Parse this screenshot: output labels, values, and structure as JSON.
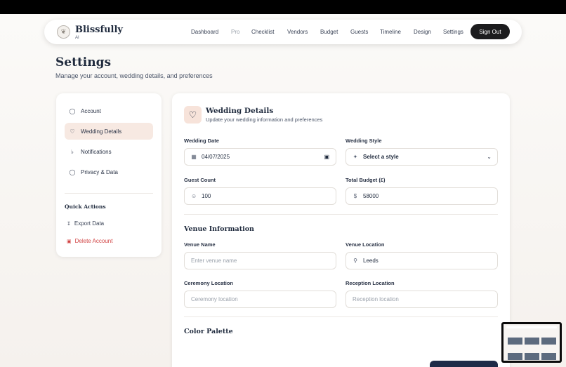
{
  "brand": {
    "name": "Blissfully",
    "sub": "AI"
  },
  "nav": {
    "links": [
      "Dashboard",
      "Pro",
      "Checklist",
      "Vendors",
      "Budget",
      "Guests",
      "Timeline",
      "Design",
      "Settings"
    ],
    "signout": "Sign Out"
  },
  "page": {
    "title": "Settings",
    "subtitle": "Manage your account, wedding details, and preferences"
  },
  "sidebar": {
    "items": [
      {
        "label": "Account",
        "icon": "user-icon"
      },
      {
        "label": "Wedding Details",
        "icon": "heart-icon",
        "active": true
      },
      {
        "label": "Notifications",
        "icon": "bell-icon"
      },
      {
        "label": "Privacy & Data",
        "icon": "shield-icon"
      }
    ],
    "quick_actions_title": "Quick Actions",
    "quick_actions": [
      {
        "label": "Export Data",
        "icon": "download-icon"
      },
      {
        "label": "Delete Account",
        "icon": "trash-icon",
        "danger": true
      }
    ]
  },
  "wedding": {
    "title": "Wedding Details",
    "subtitle": "Update your wedding information and preferences",
    "date_label": "Wedding Date",
    "date_value": "04/07/2025",
    "style_label": "Wedding Style",
    "style_value": "Select a style",
    "guest_label": "Guest Count",
    "guest_value": "100",
    "budget_label": "Total Budget (£)",
    "budget_value": "58000"
  },
  "venue": {
    "title": "Venue Information",
    "name_label": "Venue Name",
    "name_placeholder": "Enter venue name",
    "location_label": "Venue Location",
    "location_value": "Leeds",
    "ceremony_label": "Ceremony Location",
    "ceremony_placeholder": "Ceremony location",
    "reception_label": "Reception Location",
    "reception_placeholder": "Reception location"
  },
  "palette": {
    "title": "Color Palette"
  },
  "colors": {
    "accent": "#f7e9e2",
    "dark": "#1c1c1e",
    "danger": "#d14343",
    "navy": "#1e2b48"
  }
}
